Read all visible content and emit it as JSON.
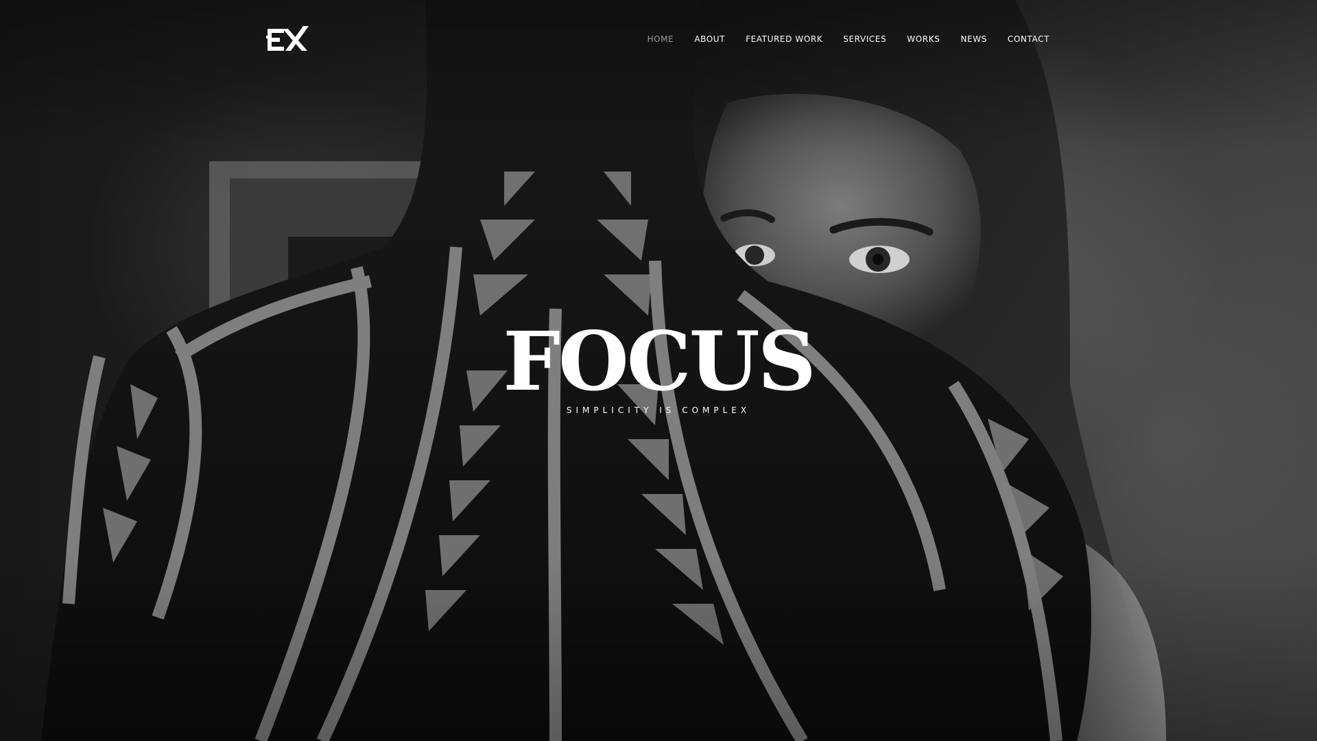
{
  "brand": {
    "logo_text": "EX",
    "logo_icon": "ex-monogram-logo"
  },
  "nav": {
    "items": [
      {
        "label": "HOME",
        "active": true
      },
      {
        "label": "ABOUT",
        "active": false
      },
      {
        "label": "FEATURED WORK",
        "active": false
      },
      {
        "label": "SERVICES",
        "active": false
      },
      {
        "label": "WORKS",
        "active": false
      },
      {
        "label": "NEWS",
        "active": false
      },
      {
        "label": "CONTACT",
        "active": false
      }
    ]
  },
  "hero": {
    "title": "FOCUS",
    "subtitle": "SIMPLICITY IS COMPLEX",
    "background_image": "black-and-white photo: man with tribal back tattoo, woman looking over his shoulder"
  },
  "colors": {
    "text": "#ffffff",
    "nav_active": "#9a9a9a",
    "background": "#1b1b1b"
  }
}
